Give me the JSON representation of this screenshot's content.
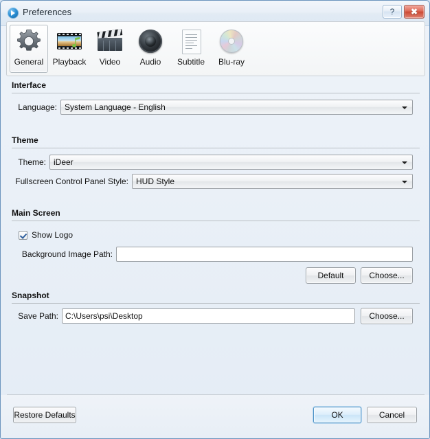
{
  "window": {
    "title": "Preferences",
    "app_icon": "media-player-icon",
    "help_label": "?",
    "close_label": "✖"
  },
  "toolbar": {
    "items": [
      {
        "label": "General",
        "icon": "gear-icon",
        "selected": true
      },
      {
        "label": "Playback",
        "icon": "film-icon",
        "selected": false
      },
      {
        "label": "Video",
        "icon": "clapper-icon",
        "selected": false
      },
      {
        "label": "Audio",
        "icon": "speaker-icon",
        "selected": false
      },
      {
        "label": "Subtitle",
        "icon": "document-icon",
        "selected": false
      },
      {
        "label": "Blu-ray",
        "icon": "disc-icon",
        "selected": false
      }
    ]
  },
  "sections": {
    "interface": {
      "title": "Interface",
      "language_label": "Language:",
      "language_value": "System Language - English"
    },
    "theme": {
      "title": "Theme",
      "theme_label": "Theme:",
      "theme_value": "iDeer",
      "fullscreen_label": "Fullscreen Control Panel Style:",
      "fullscreen_value": "HUD Style"
    },
    "main_screen": {
      "title": "Main Screen",
      "show_logo_label": "Show Logo",
      "show_logo_checked": true,
      "bg_path_label": "Background Image Path:",
      "bg_path_value": "",
      "bg_path_placeholder": "",
      "default_button": "Default",
      "choose_button": "Choose..."
    },
    "snapshot": {
      "title": "Snapshot",
      "save_path_label": "Save Path:",
      "save_path_value": "C:\\Users\\psi\\Desktop",
      "choose_button": "Choose..."
    }
  },
  "footer": {
    "restore_defaults": "Restore Defaults",
    "ok": "OK",
    "cancel": "Cancel"
  },
  "colors": {
    "accent_blue": "#4e94c8",
    "close_red": "#cc4a34",
    "window_border": "#6a93bd"
  }
}
